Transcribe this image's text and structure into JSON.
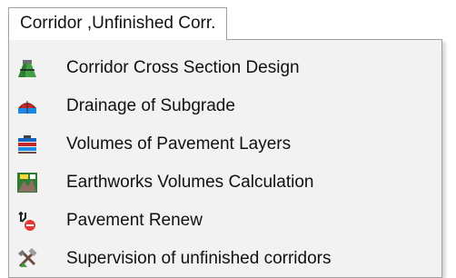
{
  "menu": {
    "title": "Corridor ,Unfinished Corr.",
    "items": [
      {
        "label": "Corridor Cross Section Design",
        "icon": "cross-section-icon"
      },
      {
        "label": "Drainage of Subgrade",
        "icon": "drainage-icon"
      },
      {
        "label": "Volumes of Pavement Layers",
        "icon": "pavement-layers-icon"
      },
      {
        "label": "Earthworks Volumes Calculation",
        "icon": "earthworks-icon"
      },
      {
        "label": "Pavement Renew",
        "icon": "pavement-renew-icon"
      },
      {
        "label": "Supervision of unfinished corridors",
        "icon": "supervision-icon"
      }
    ]
  }
}
